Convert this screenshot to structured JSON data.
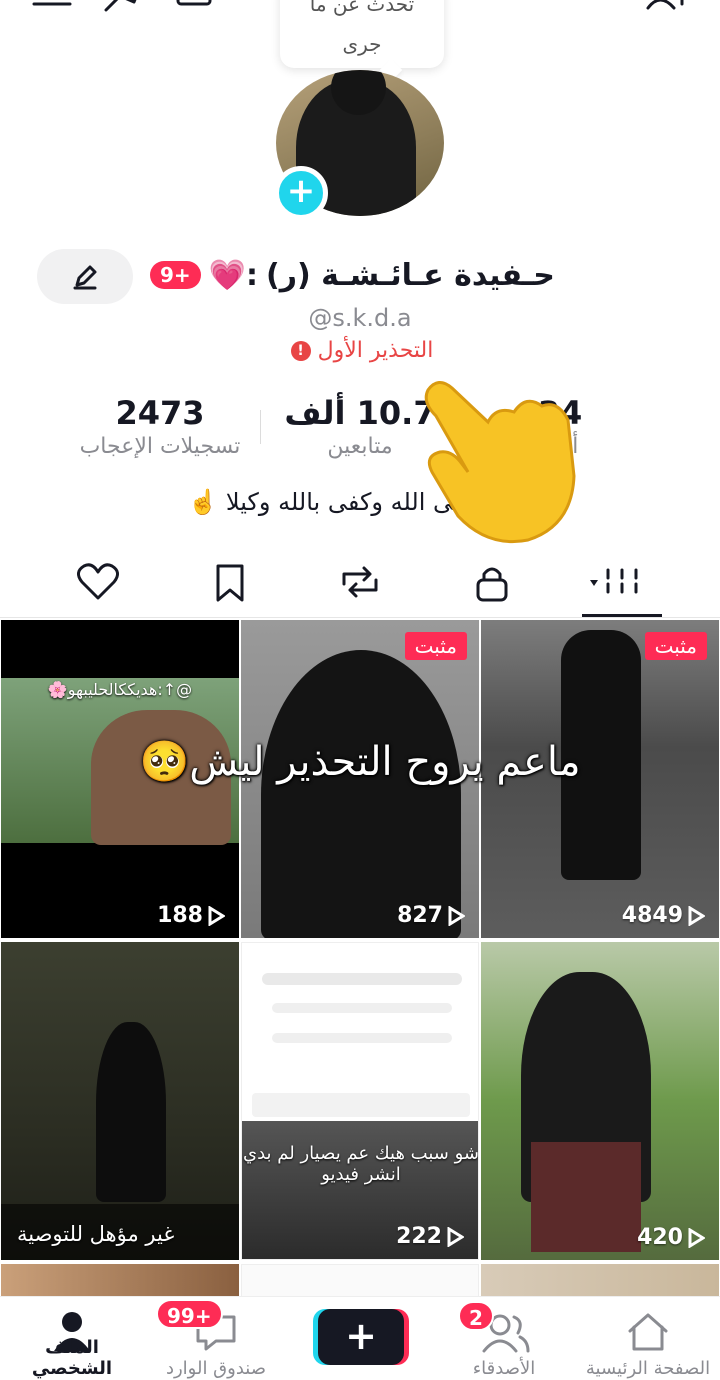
{
  "bubble": {
    "line1": "تحدث عن ما",
    "line2": "جرى"
  },
  "profile": {
    "name": "حـفيدة عـائـشـة (ر)",
    "name_suffix": "💗:",
    "badge": "9+",
    "handle": "@s.k.d.a",
    "warning": "التحذير الأول",
    "bio": "توكل على الله وكفى بالله وكيلا ☝️"
  },
  "stats": {
    "following": {
      "value": "34",
      "label": "أتابع"
    },
    "followers": {
      "value": "10.7 ألف",
      "label": "متابعين"
    },
    "likes": {
      "value": "2473",
      "label": "تسجيلات الإعجاب"
    }
  },
  "tabs": [
    "videos",
    "private",
    "reposts",
    "favorites",
    "liked"
  ],
  "videos_overlay_text": "ماعم يروح التحذير ليش🥺",
  "videos": [
    {
      "views": "4849",
      "pinned": "مثبت"
    },
    {
      "views": "827",
      "pinned": "مثبت"
    },
    {
      "views": "188",
      "top_text": "@↑:هديككالحليبهو🌸"
    },
    {
      "views": "420"
    },
    {
      "views": "222",
      "mini_caption": "شو سبب هيك عم يصيار لم بدي انشر فيديو"
    },
    {
      "views": "",
      "caption": "غير مؤهل للتوصية"
    }
  ],
  "bottom_nav": {
    "home": "الصفحة الرئيسية",
    "friends": "الأصدقاء",
    "friends_badge": "2",
    "create": "+",
    "inbox": "صندوق الوارد",
    "inbox_badge": "99+",
    "profile": "الملف الشخصي"
  },
  "colors": {
    "accent_red": "#fe2c55",
    "accent_cyan": "#20d5ec",
    "warning_red": "#e84545"
  }
}
